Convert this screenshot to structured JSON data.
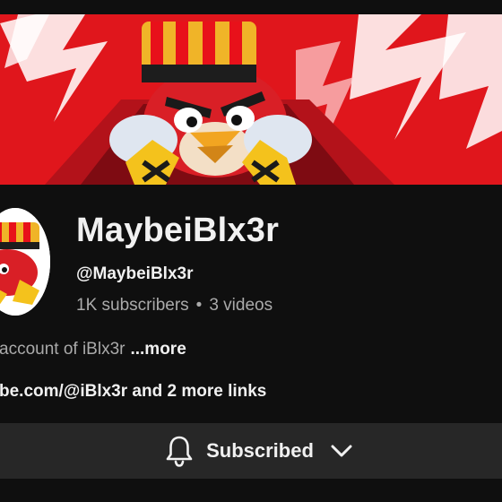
{
  "channel": {
    "name": "MaybeiBlx3r",
    "handle": "@MaybeiBlx3r",
    "subscribers": "1K subscribers",
    "separator": "•",
    "videos": "3 videos"
  },
  "description": {
    "text": "account of iBlx3r",
    "more_label": "...more"
  },
  "links": {
    "primary": "be.com/@iBlx3r",
    "extra": "and 2 more links"
  },
  "subscribe_button": {
    "label": "Subscribed",
    "bell_icon": "bell-icon",
    "chevron_icon": "chevron-down-icon"
  },
  "colors": {
    "background": "#0f0f0f",
    "banner_red": "#e0161c",
    "button_bg": "#272727",
    "text_primary": "#f1f1f1",
    "text_secondary": "#aaaaaa"
  }
}
